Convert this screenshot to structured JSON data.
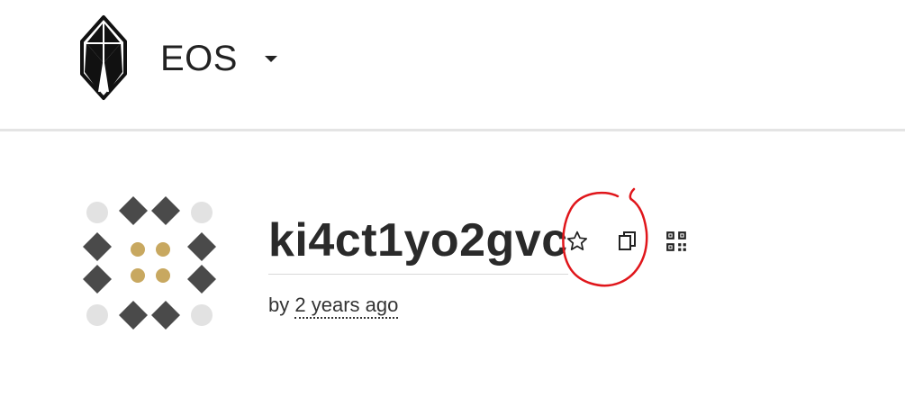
{
  "header": {
    "network_label": "EOS",
    "logo_icon": "eos-logo-icon",
    "dropdown_icon": "caret-down-icon"
  },
  "account": {
    "name": "ki4ct1yo2gvc",
    "by_label": "by",
    "created_ago": "2 years ago",
    "avatar_icon": "identicon-avatar",
    "actions": {
      "favorite_icon": "star-outline-icon",
      "copy_icon": "copy-icon",
      "qr_icon": "qr-code-icon"
    }
  },
  "colors": {
    "text": "#222222",
    "divider": "#e4e4e4",
    "avatar_dark": "#4a4a4a",
    "avatar_light": "#e2e2e2",
    "avatar_gold": "#c8a860",
    "annotation_red": "#e0161b"
  }
}
